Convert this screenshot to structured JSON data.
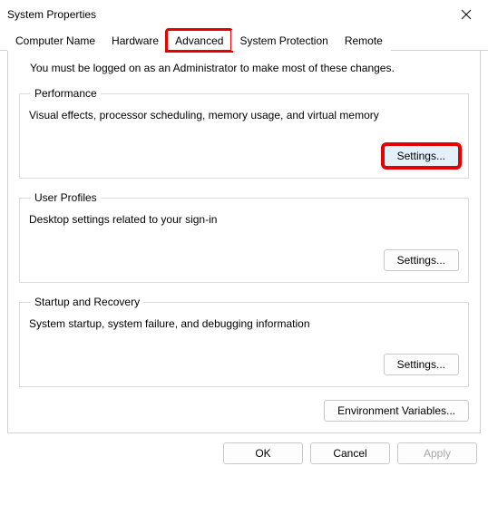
{
  "window": {
    "title": "System Properties"
  },
  "tabs": {
    "computer_name": "Computer Name",
    "hardware": "Hardware",
    "advanced": "Advanced",
    "system_protection": "System Protection",
    "remote": "Remote"
  },
  "admin_note": "You must be logged on as an Administrator to make most of these changes.",
  "performance": {
    "legend": "Performance",
    "desc": "Visual effects, processor scheduling, memory usage, and virtual memory",
    "settings_btn": "Settings..."
  },
  "user_profiles": {
    "legend": "User Profiles",
    "desc": "Desktop settings related to your sign-in",
    "settings_btn": "Settings..."
  },
  "startup_recovery": {
    "legend": "Startup and Recovery",
    "desc": "System startup, system failure, and debugging information",
    "settings_btn": "Settings..."
  },
  "env_vars_btn": "Environment Variables...",
  "buttons": {
    "ok": "OK",
    "cancel": "Cancel",
    "apply": "Apply"
  }
}
